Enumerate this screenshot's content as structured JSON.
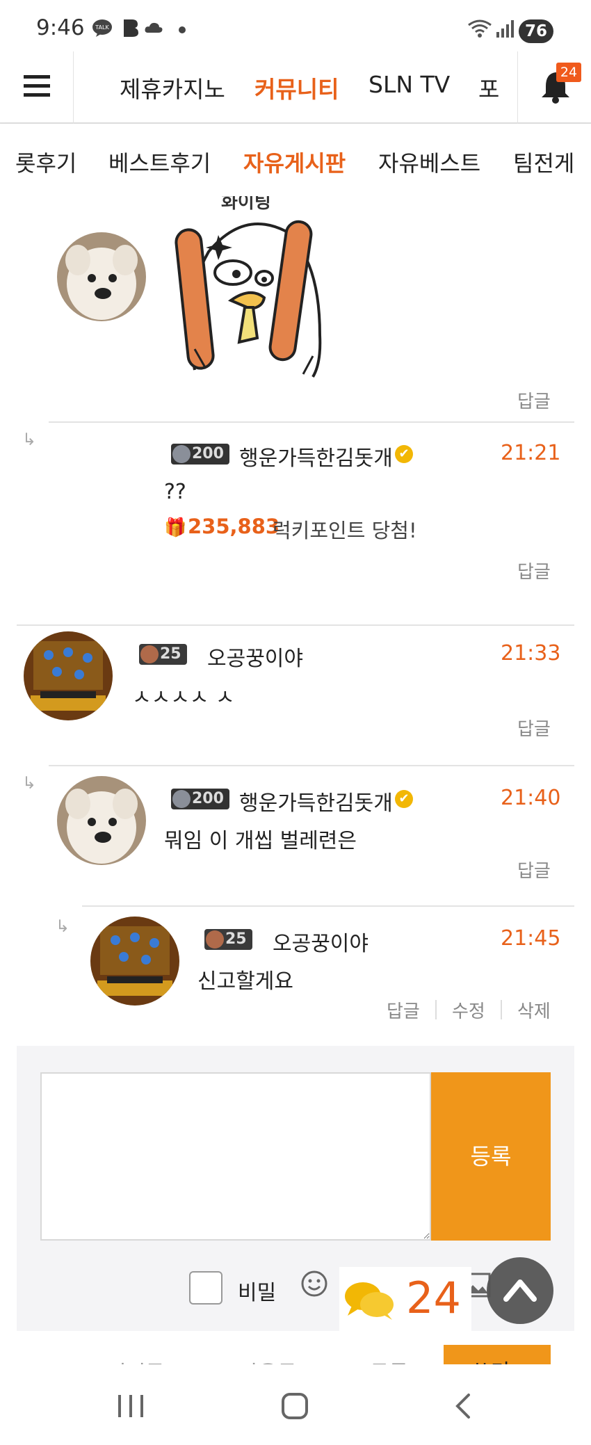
{
  "status_bar": {
    "time": "9:46",
    "battery": "76",
    "left_icons": [
      "kakaotalk-icon",
      "b-app-icon",
      "cloud-icon",
      "dot-icon"
    ],
    "right_icons": [
      "wifi-icon",
      "signal-icon",
      "battery-icon"
    ]
  },
  "top_nav": {
    "items": [
      "제휴카지노",
      "커뮤니티",
      "SLN TV",
      "포"
    ],
    "active_index": 1,
    "notification_count": "24"
  },
  "sub_nav": {
    "items": [
      "롯후기",
      "베스트후기",
      "자유게시판",
      "자유베스트",
      "팀전게"
    ],
    "active_index": 2
  },
  "sticker": {
    "text": "화이팅"
  },
  "first_reply_label": "답글",
  "comments": [
    {
      "level": "200",
      "username": "행운가득한김돗개",
      "verified": true,
      "time": "21:21",
      "text": "??",
      "prize_amount": "235,883",
      "prize_suffix": "럭키포인트 당첨!",
      "reply_label": "답글"
    },
    {
      "level": "25",
      "username": "오공꿍이야",
      "verified": false,
      "time": "21:33",
      "text": "ㅅㅅㅅㅅ ㅅ",
      "reply_label": "답글"
    },
    {
      "level": "200",
      "username": "행운가득한김돗개",
      "verified": true,
      "time": "21:40",
      "text": "뭐임 이 개씹 벌레련은",
      "reply_label": "답글"
    },
    {
      "level": "25",
      "username": "오공꿍이야",
      "verified": false,
      "time": "21:45",
      "text": "신고할게요",
      "actions": [
        "답글",
        "수정",
        "삭제"
      ]
    }
  ],
  "comment_form": {
    "submit_label": "등록",
    "secret_label": "비밀",
    "comment_count": "24"
  },
  "bottom_partial": {
    "items": [
      "이전글",
      "다음글",
      "목록",
      "쓰기"
    ]
  },
  "colors": {
    "accent": "#e8611a",
    "submit": "#f0961a",
    "badge": "#f05a1c"
  }
}
